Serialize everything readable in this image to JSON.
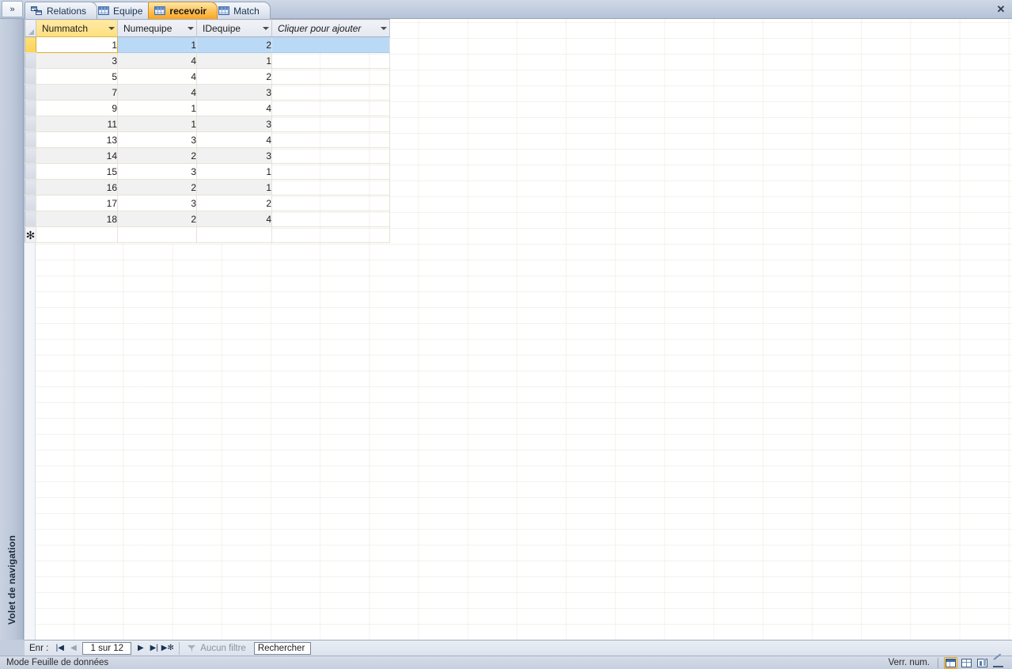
{
  "window": {
    "close_label": "✕"
  },
  "navpane": {
    "expand_icon": "»",
    "title": "Volet de navigation"
  },
  "tabs": [
    {
      "label": "Relations",
      "icon": "relations-icon",
      "active": false
    },
    {
      "label": "Equipe",
      "icon": "table-icon",
      "active": false
    },
    {
      "label": "recevoir",
      "icon": "table-icon",
      "active": true
    },
    {
      "label": "Match",
      "icon": "table-icon",
      "active": false
    }
  ],
  "datasheet": {
    "columns": [
      {
        "name": "Nummatch",
        "active": true,
        "italic": false
      },
      {
        "name": "Numequipe",
        "active": false,
        "italic": false
      },
      {
        "name": "IDequipe",
        "active": false,
        "italic": false
      },
      {
        "name": "Cliquer pour ajouter",
        "active": false,
        "italic": true
      }
    ],
    "rows": [
      {
        "Nummatch": "1",
        "Numequipe": "1",
        "IDequipe": "2",
        "current": true
      },
      {
        "Nummatch": "3",
        "Numequipe": "4",
        "IDequipe": "1",
        "current": false
      },
      {
        "Nummatch": "5",
        "Numequipe": "4",
        "IDequipe": "2",
        "current": false
      },
      {
        "Nummatch": "7",
        "Numequipe": "4",
        "IDequipe": "3",
        "current": false
      },
      {
        "Nummatch": "9",
        "Numequipe": "1",
        "IDequipe": "4",
        "current": false
      },
      {
        "Nummatch": "11",
        "Numequipe": "1",
        "IDequipe": "3",
        "current": false
      },
      {
        "Nummatch": "13",
        "Numequipe": "3",
        "IDequipe": "4",
        "current": false
      },
      {
        "Nummatch": "14",
        "Numequipe": "2",
        "IDequipe": "3",
        "current": false
      },
      {
        "Nummatch": "15",
        "Numequipe": "3",
        "IDequipe": "1",
        "current": false
      },
      {
        "Nummatch": "16",
        "Numequipe": "2",
        "IDequipe": "1",
        "current": false
      },
      {
        "Nummatch": "17",
        "Numequipe": "3",
        "IDequipe": "2",
        "current": false
      },
      {
        "Nummatch": "18",
        "Numequipe": "2",
        "IDequipe": "4",
        "current": false
      }
    ],
    "new_record_marker": "✻"
  },
  "recnav": {
    "label": "Enr :",
    "first_icon": "|◀",
    "prev_icon": "◀",
    "position": "1 sur 12",
    "next_icon": "▶",
    "last_icon": "▶|",
    "new_icon": "▶✻",
    "filter_label": "Aucun filtre",
    "search_placeholder": "Rechercher"
  },
  "statusbar": {
    "mode": "Mode Feuille de données",
    "numlock": "Verr. num.",
    "views": [
      {
        "name": "datasheet-view",
        "active": true
      },
      {
        "name": "pivot-table-view",
        "active": false
      },
      {
        "name": "pivot-chart-view",
        "active": false
      },
      {
        "name": "design-view",
        "active": false
      }
    ]
  },
  "colors": {
    "accent_orange": "#fba422",
    "selection_blue": "#b9d9f7",
    "current_row_gold": "#fdd25b",
    "chrome_blue": "#c3cddd"
  }
}
